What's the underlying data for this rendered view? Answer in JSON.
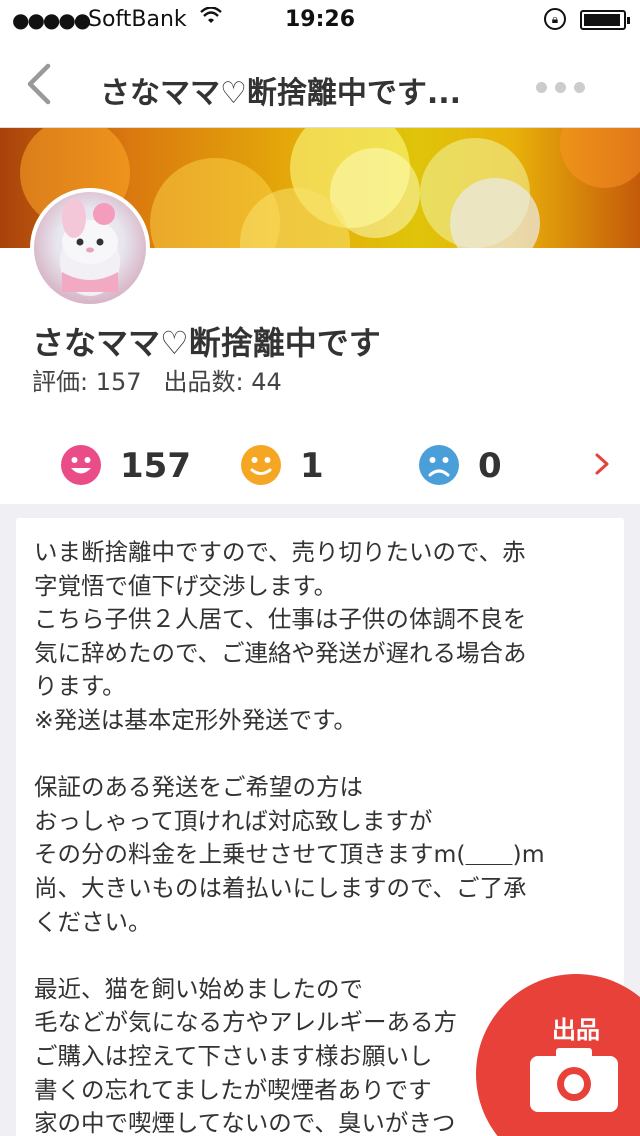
{
  "status_bar": {
    "signal": "●●●●●",
    "carrier": "SoftBank",
    "time": "19:26"
  },
  "nav": {
    "title": "さなママ♡断捨離中です..."
  },
  "profile": {
    "name": "さなママ♡断捨離中です",
    "rating_label": "評価: 157",
    "listings_label": "出品数: 44"
  },
  "ratings": {
    "good": "157",
    "normal": "1",
    "bad": "0"
  },
  "description": "いま断捨離中ですので、売り切りたいので、赤\n字覚悟で値下げ交渉します。\nこちら子供２人居て、仕事は子供の体調不良を\n気に辞めたので、ご連絡や発送が遅れる場合あ\nります。\n※発送は基本定形外発送です。\n\n保証のある発送をご希望の方は\nおっしゃって頂ければ対応致しますが\nその分の料金を上乗せさせて頂きますm(＿＿)m\n尚、大きいものは着払いにしますので、ご了承\nください。\n\n最近、猫を飼い始めましたので\n毛などが気になる方やアレルギーある方\nご購入は控えて下さいます様お願いし\n書くの忘れてましたが喫煙者ありです\n家の中で喫煙してないので、臭いがきつ",
  "fab": {
    "label": "出品"
  },
  "colors": {
    "accent": "#e8413a",
    "good": "#ea4c89",
    "normal": "#f5a623",
    "bad": "#4a9fd8"
  },
  "icons": {
    "back": "chevron-left-icon",
    "more": "more-dots-icon",
    "good": "smile-face-icon",
    "normal": "neutral-face-icon",
    "bad": "sad-face-icon",
    "next": "chevron-right-icon",
    "camera": "camera-icon"
  }
}
